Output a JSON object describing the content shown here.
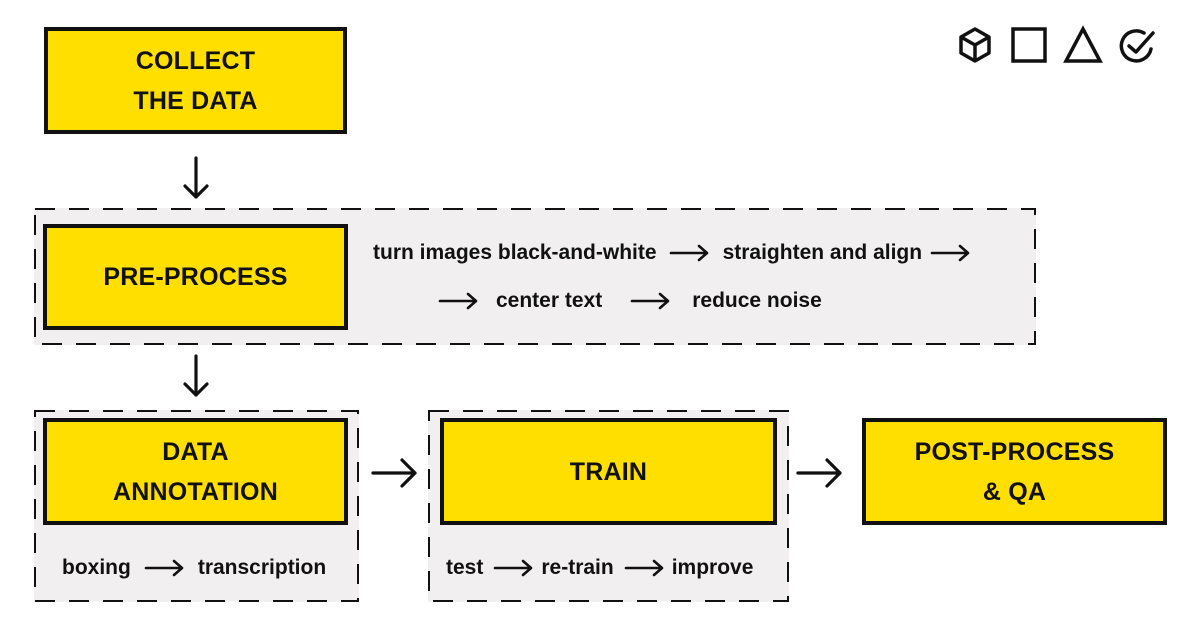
{
  "icons": [
    "cube-icon",
    "square-icon",
    "triangle-icon",
    "check-circle-icon"
  ],
  "colors": {
    "box_fill": "#FFDF00",
    "group_fill": "#F1EFF0",
    "stroke": "#111111"
  },
  "steps": {
    "collect": {
      "line1": "COLLECT",
      "line2": "THE DATA"
    },
    "preprocess": {
      "label": "PRE-PROCESS",
      "substeps_row1": [
        "turn images black-and-white",
        "straighten and align"
      ],
      "substeps_row2": [
        "center text",
        "reduce noise"
      ]
    },
    "annotation": {
      "line1": "DATA",
      "line2": "ANNOTATION",
      "substeps": [
        "boxing",
        "transcription"
      ]
    },
    "train": {
      "label": "TRAIN",
      "substeps": [
        "test",
        "re-train",
        "improve"
      ]
    },
    "postprocess": {
      "line1": "POST-PROCESS",
      "line2": "& QA"
    }
  }
}
